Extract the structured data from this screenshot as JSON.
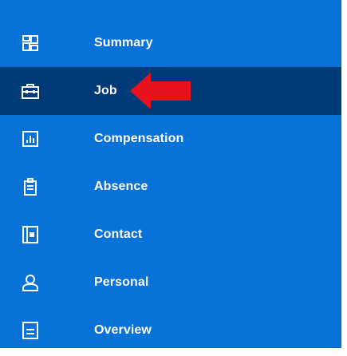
{
  "colors": {
    "sidebar_bg": "#0872d8",
    "active_bg": "#003a79",
    "text": "#ffffff",
    "annotation_arrow": "#e8111d"
  },
  "nav": {
    "items": [
      {
        "label": "Summary",
        "icon": "grid-icon",
        "active": false
      },
      {
        "label": "Job",
        "icon": "briefcase-icon",
        "active": true
      },
      {
        "label": "Compensation",
        "icon": "bar-chart-icon",
        "active": false
      },
      {
        "label": "Absence",
        "icon": "clipboard-icon",
        "active": false
      },
      {
        "label": "Contact",
        "icon": "contact-book-icon",
        "active": false
      },
      {
        "label": "Personal",
        "icon": "person-icon",
        "active": false
      },
      {
        "label": "Overview",
        "icon": "document-icon",
        "active": false
      }
    ]
  },
  "annotation": {
    "icon": "red-arrow-left-icon",
    "points_to": "Job"
  }
}
